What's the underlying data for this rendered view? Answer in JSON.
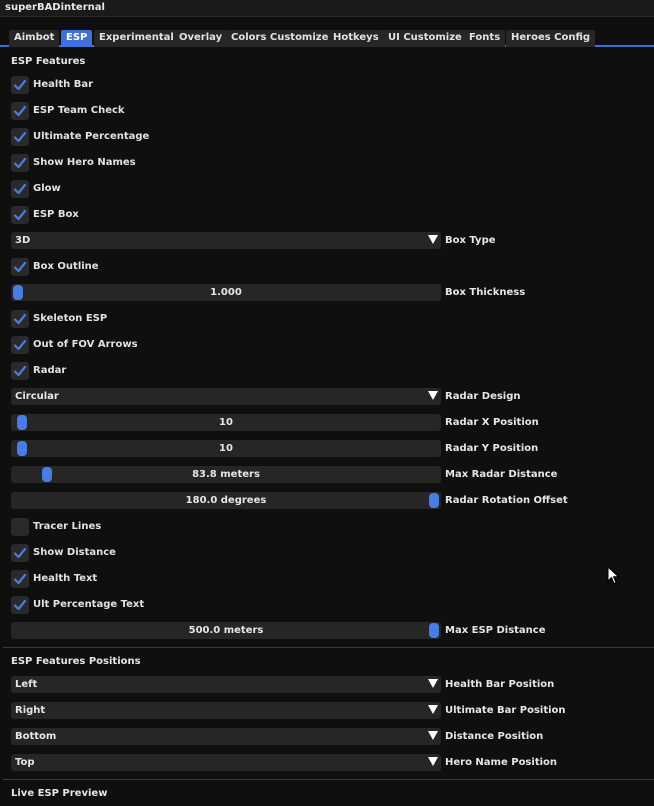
{
  "window": {
    "title": "superBADinternal"
  },
  "tabs": [
    "Aimbot",
    "ESP",
    "Experimental",
    "Overlay",
    "Colors Customize",
    "Hotkeys",
    "UI Customize",
    "Fonts",
    "Heroes Config"
  ],
  "active_tab": "ESP",
  "esp_features": {
    "title": "ESP Features",
    "health_bar": {
      "label": "Health Bar",
      "checked": true
    },
    "team_check": {
      "label": "ESP Team Check",
      "checked": true
    },
    "ultimate_percentage": {
      "label": "Ultimate Percentage",
      "checked": true
    },
    "show_hero_names": {
      "label": "Show Hero Names",
      "checked": true
    },
    "glow": {
      "label": "Glow",
      "checked": true
    },
    "esp_box": {
      "label": "ESP Box",
      "checked": true
    },
    "box_type": {
      "value": "3D",
      "label": "Box Type"
    },
    "box_outline": {
      "label": "Box Outline",
      "checked": true
    },
    "box_thickness": {
      "value": "1.000",
      "label": "Box Thickness",
      "fraction": 0.0
    },
    "skeleton_esp": {
      "label": "Skeleton ESP",
      "checked": true
    },
    "fov_arrows": {
      "label": "Out of FOV Arrows",
      "checked": true
    },
    "radar": {
      "label": "Radar",
      "checked": true
    },
    "radar_design": {
      "value": "Circular",
      "label": "Radar Design"
    },
    "radar_x": {
      "value": "10",
      "label": "Radar X Position",
      "fraction": 0.01
    },
    "radar_y": {
      "value": "10",
      "label": "Radar Y Position",
      "fraction": 0.01
    },
    "max_radar_distance": {
      "value": "83.8 meters",
      "label": "Max Radar Distance",
      "fraction": 0.07
    },
    "radar_rotation": {
      "value": "180.0 degrees",
      "label": "Radar Rotation Offset",
      "fraction": 1.0
    },
    "tracer_lines": {
      "label": "Tracer Lines",
      "checked": false
    },
    "show_distance": {
      "label": "Show Distance",
      "checked": true
    },
    "health_text": {
      "label": "Health Text",
      "checked": true
    },
    "ult_percentage_text": {
      "label": "Ult Percentage Text",
      "checked": true
    },
    "max_esp_distance": {
      "value": "500.0 meters",
      "label": "Max ESP Distance",
      "fraction": 1.0
    }
  },
  "positions": {
    "title": "ESP Features Positions",
    "health_bar_position": {
      "value": "Left",
      "label": "Health Bar Position"
    },
    "ultimate_bar_position": {
      "value": "Right",
      "label": "Ultimate Bar Position"
    },
    "distance_position": {
      "value": "Bottom",
      "label": "Distance Position"
    },
    "hero_name_position": {
      "value": "Top",
      "label": "Hero Name Position"
    }
  },
  "preview": {
    "title": "Live ESP Preview"
  },
  "colors": {
    "accent": "#4a7ce6",
    "tab_active": "#3f6fd8",
    "frame": "#262626",
    "background": "#0f0f0f"
  }
}
